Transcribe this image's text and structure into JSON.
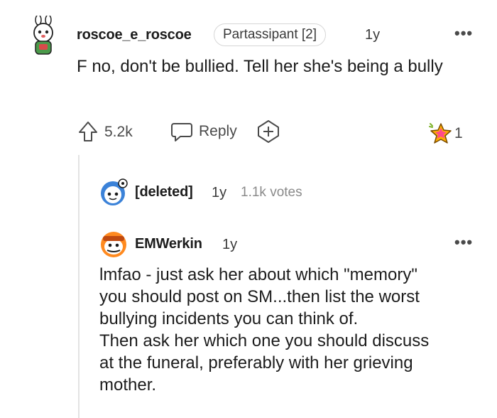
{
  "comments": [
    {
      "username": "roscoe_e_roscoe",
      "flair": "Partassipant [2]",
      "age": "1y",
      "more": "•••",
      "body": "F no, don't be bullied. Tell her she's being a bully",
      "actions": {
        "upvote_count": "5.2k",
        "reply_label": "Reply",
        "award_count": "1"
      }
    },
    {
      "username": "[deleted]",
      "age": "1y",
      "votes": "1.1k votes"
    },
    {
      "username": "EMWerkin",
      "age": "1y",
      "more": "•••",
      "body_lines": [
        "lmfao - just ask her about which \"memory\"",
        "you should post on SM...then list the worst",
        "bullying incidents you can think of.",
        "Then ask her which one you should discuss",
        "at the funeral, preferably with her grieving",
        "mother."
      ]
    }
  ],
  "colors": {
    "accent": "#ff4500",
    "avatar_green": "#7fb32b",
    "avatar_blue": "#3b82d8",
    "avatar_orange": "#ff8a1f"
  }
}
